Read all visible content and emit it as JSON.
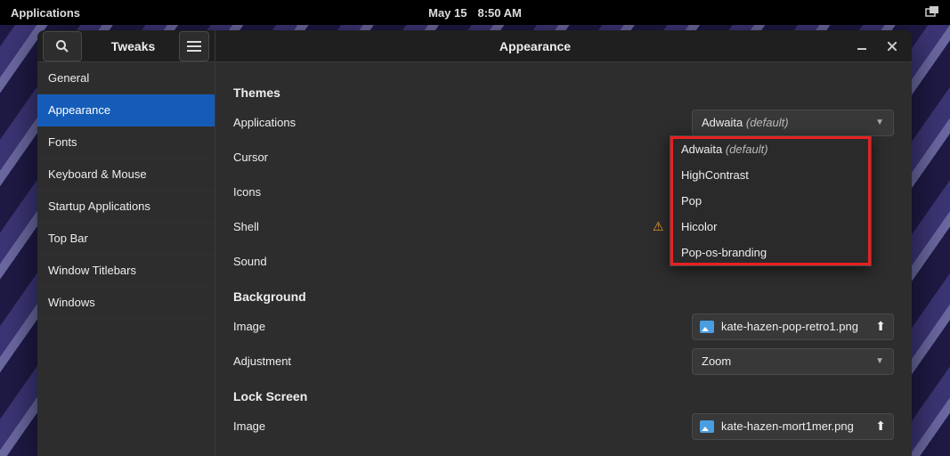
{
  "topbar": {
    "app_menu": "Applications",
    "date": "May 15",
    "time": "8:50 AM"
  },
  "window": {
    "appname": "Tweaks",
    "title": "Appearance"
  },
  "sidebar": {
    "items": [
      "General",
      "Appearance",
      "Fonts",
      "Keyboard & Mouse",
      "Startup Applications",
      "Top Bar",
      "Window Titlebars",
      "Windows"
    ],
    "selected_index": 1
  },
  "main": {
    "section_themes": "Themes",
    "rows": {
      "applications": {
        "label": "Applications",
        "value": "Adwaita",
        "suffix": "(default)"
      },
      "cursor": {
        "label": "Cursor"
      },
      "icons": {
        "label": "Icons"
      },
      "shell": {
        "label": "Shell"
      },
      "sound": {
        "label": "Sound"
      }
    },
    "section_background": "Background",
    "background": {
      "image_label": "Image",
      "image_file": "kate-hazen-pop-retro1.png",
      "adjustment_label": "Adjustment",
      "adjustment_value": "Zoom"
    },
    "section_lockscreen": "Lock Screen",
    "lockscreen": {
      "image_label": "Image",
      "image_file": "kate-hazen-mort1mer.png"
    }
  },
  "dropdown": {
    "items": [
      {
        "label": "Adwaita",
        "suffix": "(default)"
      },
      {
        "label": "HighContrast"
      },
      {
        "label": "Pop"
      },
      {
        "label": "Hicolor"
      },
      {
        "label": "Pop-os-branding"
      }
    ]
  }
}
